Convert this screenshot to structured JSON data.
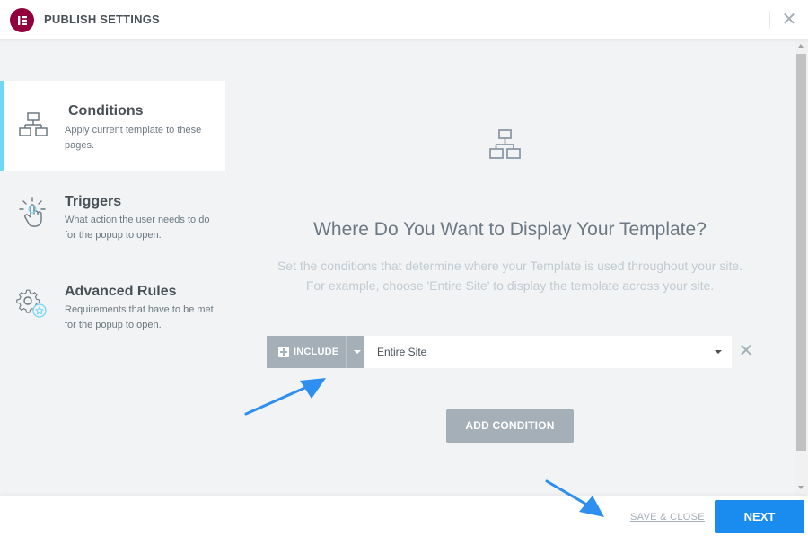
{
  "header": {
    "title": "PUBLISH SETTINGS",
    "logo_icon": "elementor-logo-icon",
    "close_icon": "close-icon"
  },
  "sidebar": {
    "items": [
      {
        "label": "Conditions",
        "description": "Apply current template to these pages.",
        "icon": "sitemap-icon",
        "active": true
      },
      {
        "label": "Triggers",
        "description": "What action the user needs to do for the popup to open.",
        "icon": "hand-pointer-icon",
        "active": false
      },
      {
        "label": "Advanced Rules",
        "description": "Requirements that have to be met for the popup to open.",
        "icon": "gears-icon",
        "active": false
      }
    ]
  },
  "main": {
    "heading": "Where Do You Want to Display Your Template?",
    "subtext_line1": "Set the conditions that determine where your Template is used throughout your site.",
    "subtext_line2": "For example, choose 'Entire Site' to display the template across your site.",
    "condition": {
      "type_label": "INCLUDE",
      "selected_value": "Entire Site"
    },
    "add_condition_label": "ADD CONDITION"
  },
  "footer": {
    "save_close_label": "SAVE & CLOSE",
    "next_label": "NEXT"
  },
  "colors": {
    "brand": "#92003b",
    "accent": "#71d7f7",
    "primary_button": "#39b54a",
    "neutral_button": "#a4afb7",
    "annotation_arrow": "#2e8ff0"
  }
}
